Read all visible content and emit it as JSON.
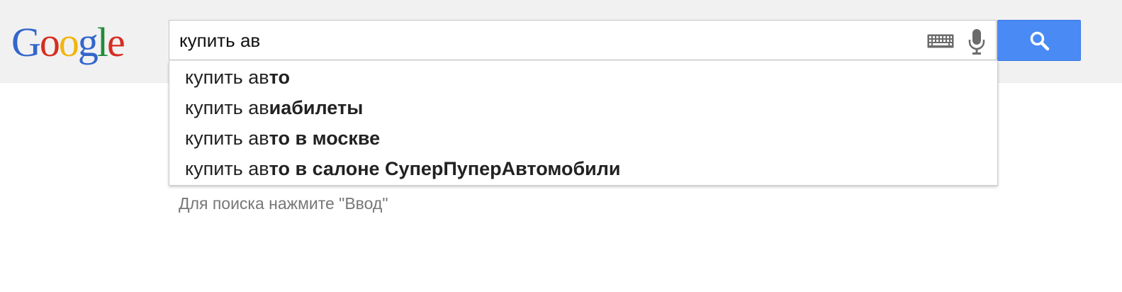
{
  "logo": {
    "letters": [
      {
        "char": "G",
        "color": "#3366cc"
      },
      {
        "char": "o",
        "color": "#d62d20"
      },
      {
        "char": "o",
        "color": "#f2b50f"
      },
      {
        "char": "g",
        "color": "#3366cc"
      },
      {
        "char": "l",
        "color": "#228b3b"
      },
      {
        "char": "e",
        "color": "#d62d20"
      }
    ]
  },
  "search": {
    "value": "купить ав",
    "keyboard_icon": "keyboard-icon",
    "mic_icon": "microphone-icon",
    "button_icon": "search-icon",
    "button_color": "#4a8af4"
  },
  "suggestions": [
    {
      "typed": "купить ав",
      "completion": "то"
    },
    {
      "typed": "купить ав",
      "completion": "иабилеты"
    },
    {
      "typed": "купить ав",
      "completion": "то в москве"
    },
    {
      "typed": "купить ав",
      "completion": "то в салоне СуперПуперАвтомобили"
    }
  ],
  "hint": "Для поиска нажмите \"Ввод\""
}
